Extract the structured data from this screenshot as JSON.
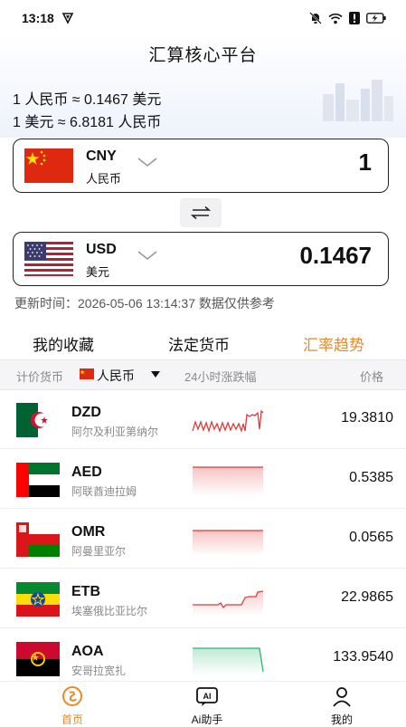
{
  "status": {
    "time": "13:18"
  },
  "header": {
    "title": "汇算核心平台",
    "rate_line_1": "1 人民币 ≈ 0.1467 美元",
    "rate_line_2": "1 美元 ≈ 6.8181 人民币"
  },
  "converter": {
    "from": {
      "code": "CNY",
      "name": "人民币",
      "amount": "1",
      "flag": "cn-flag"
    },
    "to": {
      "code": "USD",
      "name": "美元",
      "amount": "0.1467",
      "flag": "us-flag"
    },
    "update_text": "更新时间：2026-05-06 13:14:37 数据仅供参考"
  },
  "tabs": [
    "我的收藏",
    "法定货币",
    "汇率趋势"
  ],
  "active_tab": 2,
  "filter": {
    "base_label": "计价货币",
    "base_currency": "人民币",
    "change_label": "24小时涨跌幅",
    "price_label": "价格"
  },
  "rates": [
    {
      "code": "DZD",
      "name": "阿尔及利亚第纳尔",
      "price": "19.3810",
      "trend": "volatile"
    },
    {
      "code": "AED",
      "name": "阿联酋迪拉姆",
      "price": "0.5385",
      "trend": "down"
    },
    {
      "code": "OMR",
      "name": "阿曼里亚尔",
      "price": "0.0565",
      "trend": "down"
    },
    {
      "code": "ETB",
      "name": "埃塞俄比亚比尔",
      "price": "22.9865",
      "trend": "up"
    },
    {
      "code": "AOA",
      "name": "安哥拉宽扎",
      "price": "133.9540",
      "trend": "down-green"
    }
  ],
  "nav": [
    {
      "label": "首页",
      "icon": "home-icon"
    },
    {
      "label": "Ai助手",
      "icon": "ai-icon"
    },
    {
      "label": "我的",
      "icon": "profile-icon"
    }
  ],
  "colors": {
    "accent": "#e8892c",
    "up": "#e03b3b",
    "down": "#2bb673"
  }
}
